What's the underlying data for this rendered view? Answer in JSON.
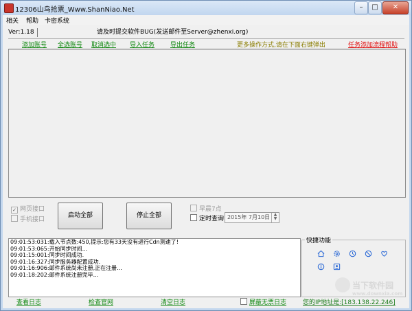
{
  "window": {
    "title": "12306山鸟抢票_Www.ShanNiao.Net"
  },
  "menu": [
    "相关",
    "帮助",
    "卡密系统"
  ],
  "header": {
    "version": "Ver:1.18",
    "notice": "请及时提交软件BUG(发送邮件至Server@zhenxi.org)"
  },
  "toolbar": {
    "add_account": "添加账号",
    "select_all": "全选账号",
    "deselect": "取消选中",
    "import_task": "导入任务",
    "export_task": "导出任务",
    "more_ops": "更多操作方式,请在下面右键弹出",
    "help": "任务添加流程帮助"
  },
  "options": {
    "web_port": "网页接口",
    "web_port_checked": true,
    "mobile_port": "手机接口",
    "mobile_port_checked": false,
    "start_all": "启动全部",
    "stop_all": "停止全部",
    "early7": "早晨7点",
    "timed_query": "定时查询",
    "date": "2015年 7月10日"
  },
  "log": [
    "09:01:53:031:载入节点数:450,提示:您有33天没有进行Cdn测速了!",
    "09:01:53:065:开始同步时间...",
    "09:01:15:001:同步时间成功.",
    "09:01:16:327:同步服务器配置成功.",
    "09:01:16:906:邮件系统尚未注册,正在注册...",
    "09:01:18:202:邮件系统注册完毕..."
  ],
  "quick": {
    "title": "快捷功能",
    "icons": [
      "home-icon",
      "gear-icon",
      "clock-icon",
      "ban-icon",
      "heart-icon",
      "info-icon",
      "contact-icon"
    ],
    "icon_color": "#2e6bd6"
  },
  "bottom": {
    "view_log": "查看日志",
    "check_official": "检查官网",
    "clear_log": "清空日志",
    "block_no_ticket_log": "屏蔽无票日志",
    "ip_label": "您的IP地址是:",
    "ip": "[183.138.22.246]"
  },
  "watermark": {
    "text": "当下软件园",
    "url": "www.downxia.com"
  }
}
